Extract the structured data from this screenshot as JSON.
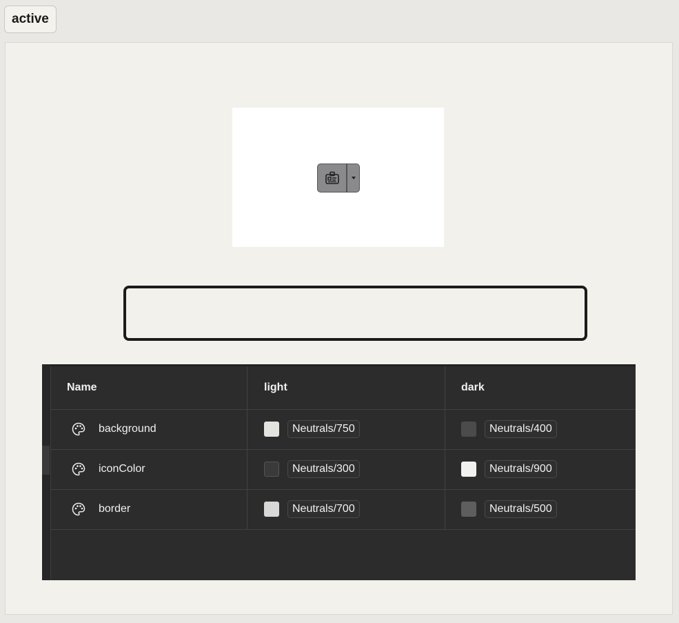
{
  "state_tag": "active",
  "table": {
    "headers": {
      "name": "Name",
      "light": "light",
      "dark": "dark"
    },
    "rows": [
      {
        "name": "background",
        "light": {
          "token": "Neutrals/750",
          "color": "#e3e3e0"
        },
        "dark": {
          "token": "Neutrals/400",
          "color": "#4b4b4b"
        }
      },
      {
        "name": "iconColor",
        "light": {
          "token": "Neutrals/300",
          "color": "#3a3a3a"
        },
        "dark": {
          "token": "Neutrals/900",
          "color": "#f1f1ef"
        }
      },
      {
        "name": "border",
        "light": {
          "token": "Neutrals/700",
          "color": "#d8d8d6"
        },
        "dark": {
          "token": "Neutrals/500",
          "color": "#5e5e5e"
        }
      }
    ]
  },
  "icons": {
    "split_button_main": "id-badge-icon",
    "split_button_caret": "caret-down-icon",
    "row_icon": "palette-icon"
  }
}
